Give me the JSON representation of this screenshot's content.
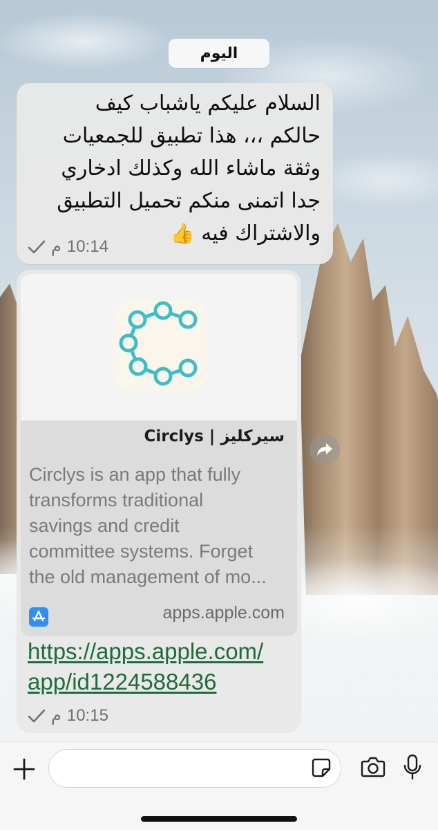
{
  "chat": {
    "date_label": "اليوم",
    "messages": [
      {
        "lines": [
          "السلام عليكم ياشباب كيف",
          "حالكم ،،، هذا تطبيق للجمعيات",
          "وثقة ماشاء الله وكذلك ادخاري",
          "جدا اتمنى منكم تحميل التطبيق",
          "والاشتراك فيه"
        ],
        "emoji": "👍",
        "time": "10:14",
        "am_pm": "م",
        "status_icon": "checkmark-icon"
      },
      {
        "preview": {
          "title": "سيركليز | Circlys",
          "description_lines": [
            "Circlys is an app that fully",
            "transforms traditional",
            "savings and credit",
            "committee systems. Forget",
            "the old management of mo..."
          ],
          "domain": "apps.apple.com",
          "source_icon": "app-store-icon",
          "logo_color": "#3fbcc6"
        },
        "link_lines": [
          "https://apps.apple.com/",
          "app/id1224588436"
        ],
        "time": "10:15",
        "am_pm": "م",
        "status_icon": "checkmark-icon"
      }
    ]
  },
  "input_bar": {
    "left_icon": "plus-icon",
    "right_icons": [
      "sticker-icon",
      "camera-icon",
      "microphone-icon"
    ]
  },
  "colors": {
    "link": "#1e6b3c",
    "bubble": "#e8e8e8",
    "accent_logo": "#3fbcc6"
  }
}
